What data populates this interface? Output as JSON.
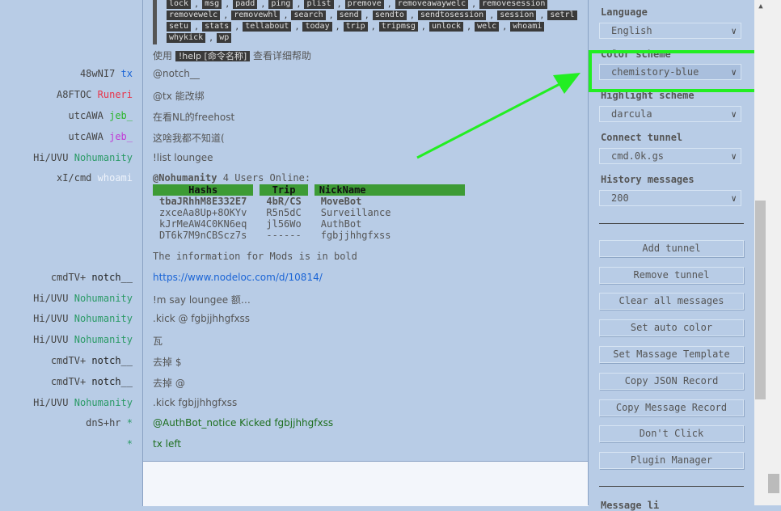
{
  "commands": [
    [
      "lock",
      "msg",
      "padd",
      "ping",
      "plist",
      "premove",
      "removeawaywelc",
      "removesession"
    ],
    [
      "removewelc",
      "removewhl",
      "search",
      "send",
      "sendto",
      "sendtosession",
      "session",
      "setrl"
    ],
    [
      "setu",
      "stats",
      "tellabout",
      "today",
      "trip",
      "tripmsg",
      "unlock",
      "welc",
      "whoami"
    ],
    [
      "whykick",
      "wp"
    ]
  ],
  "help_text": {
    "before": "使用",
    "chip": "!help [命令名称]",
    "after": "查看详细帮助"
  },
  "nicks": [
    {
      "trip": "48wNI7",
      "name": "tx",
      "color": "#1a64d6"
    },
    {
      "trip": "A8FTOC",
      "name": "Runeri",
      "color": "#e8344a"
    },
    {
      "trip": "utcAWA",
      "name": "jeb_",
      "color": "#2bb52b"
    },
    {
      "trip": "utcAWA",
      "name": "jeb_",
      "color": "#c03ad6"
    },
    {
      "trip": "Hi/UVU",
      "name": "Nohumanity",
      "color": "#2a9a66"
    },
    {
      "trip": "xI/cmd",
      "name": "whoami",
      "color": "#eef3fb"
    },
    {
      "trip": "cmdTV+",
      "name": "notch__",
      "color": "#222222"
    },
    {
      "trip": "Hi/UVU",
      "name": "Nohumanity",
      "color": "#2a9a66"
    },
    {
      "trip": "Hi/UVU",
      "name": "Nohumanity",
      "color": "#2a9a66"
    },
    {
      "trip": "Hi/UVU",
      "name": "Nohumanity",
      "color": "#2a9a66"
    },
    {
      "trip": "cmdTV+",
      "name": "notch__",
      "color": "#222222"
    },
    {
      "trip": "cmdTV+",
      "name": "notch__",
      "color": "#222222"
    },
    {
      "trip": "Hi/UVU",
      "name": "Nohumanity",
      "color": "#2a9a66"
    },
    {
      "trip": "dnS+hr",
      "name": "*",
      "color": "#2a9a66"
    },
    {
      "trip": "",
      "name": "*",
      "color": "#2a9a66"
    }
  ],
  "messages": [
    "@notch__",
    "@tx 能改绑",
    "在看NL的freehost",
    "这啥我都不知道(",
    "!list loungee",
    "",
    "The information for Mods is in bold",
    "https://www.nodeloc.com/d/10814/",
    "!m say loungee 额…",
    ".kick @ fgbjjhhgfxss",
    "瓦",
    "去掉 $",
    "去掉 @",
    ".kick fgbjjhhgfxss",
    "@AuthBot_notice Kicked fgbjjhhgfxss",
    "tx left"
  ],
  "online": {
    "prefix": "@Nohumanity",
    "count": "4",
    "suffix": "Users Online:",
    "headers": [
      "Hashs",
      "Trip",
      "NickName"
    ],
    "rows": [
      [
        "tbaJRhhM8E332E7",
        "4bR/CS",
        "MoveBot"
      ],
      [
        "zxceAa8Up+8OKYv",
        "R5n5dC",
        "Surveillance"
      ],
      [
        "kJrMeAW4C0KN6eq",
        "jl56Wo",
        "AuthBot"
      ],
      [
        "DT6k7M9nCBScz7s",
        "------",
        "fgbjjhhgfxss"
      ]
    ]
  },
  "sidebar": {
    "language_label": "Language",
    "language_value": "English",
    "color_label": "Color scheme",
    "color_value": "chemistory-blue",
    "highlight_label": "Highlight scheme",
    "highlight_value": "darcula",
    "tunnel_label": "Connect tunnel",
    "tunnel_value": "cmd.0k.gs",
    "history_label": "History messages",
    "history_value": "200",
    "buttons": [
      "Add tunnel",
      "Remove tunnel",
      "Clear all messages",
      "Set auto color",
      "Set Massage Template",
      "Copy JSON Record",
      "Copy Message Record",
      "Don't Click",
      "Plugin Manager"
    ],
    "bottom_label": "Message li"
  },
  "colors": {
    "background": "#b8cce6",
    "highlight": "#22ee22",
    "link": "#1a64d6",
    "table_header": "#3d9b35"
  }
}
